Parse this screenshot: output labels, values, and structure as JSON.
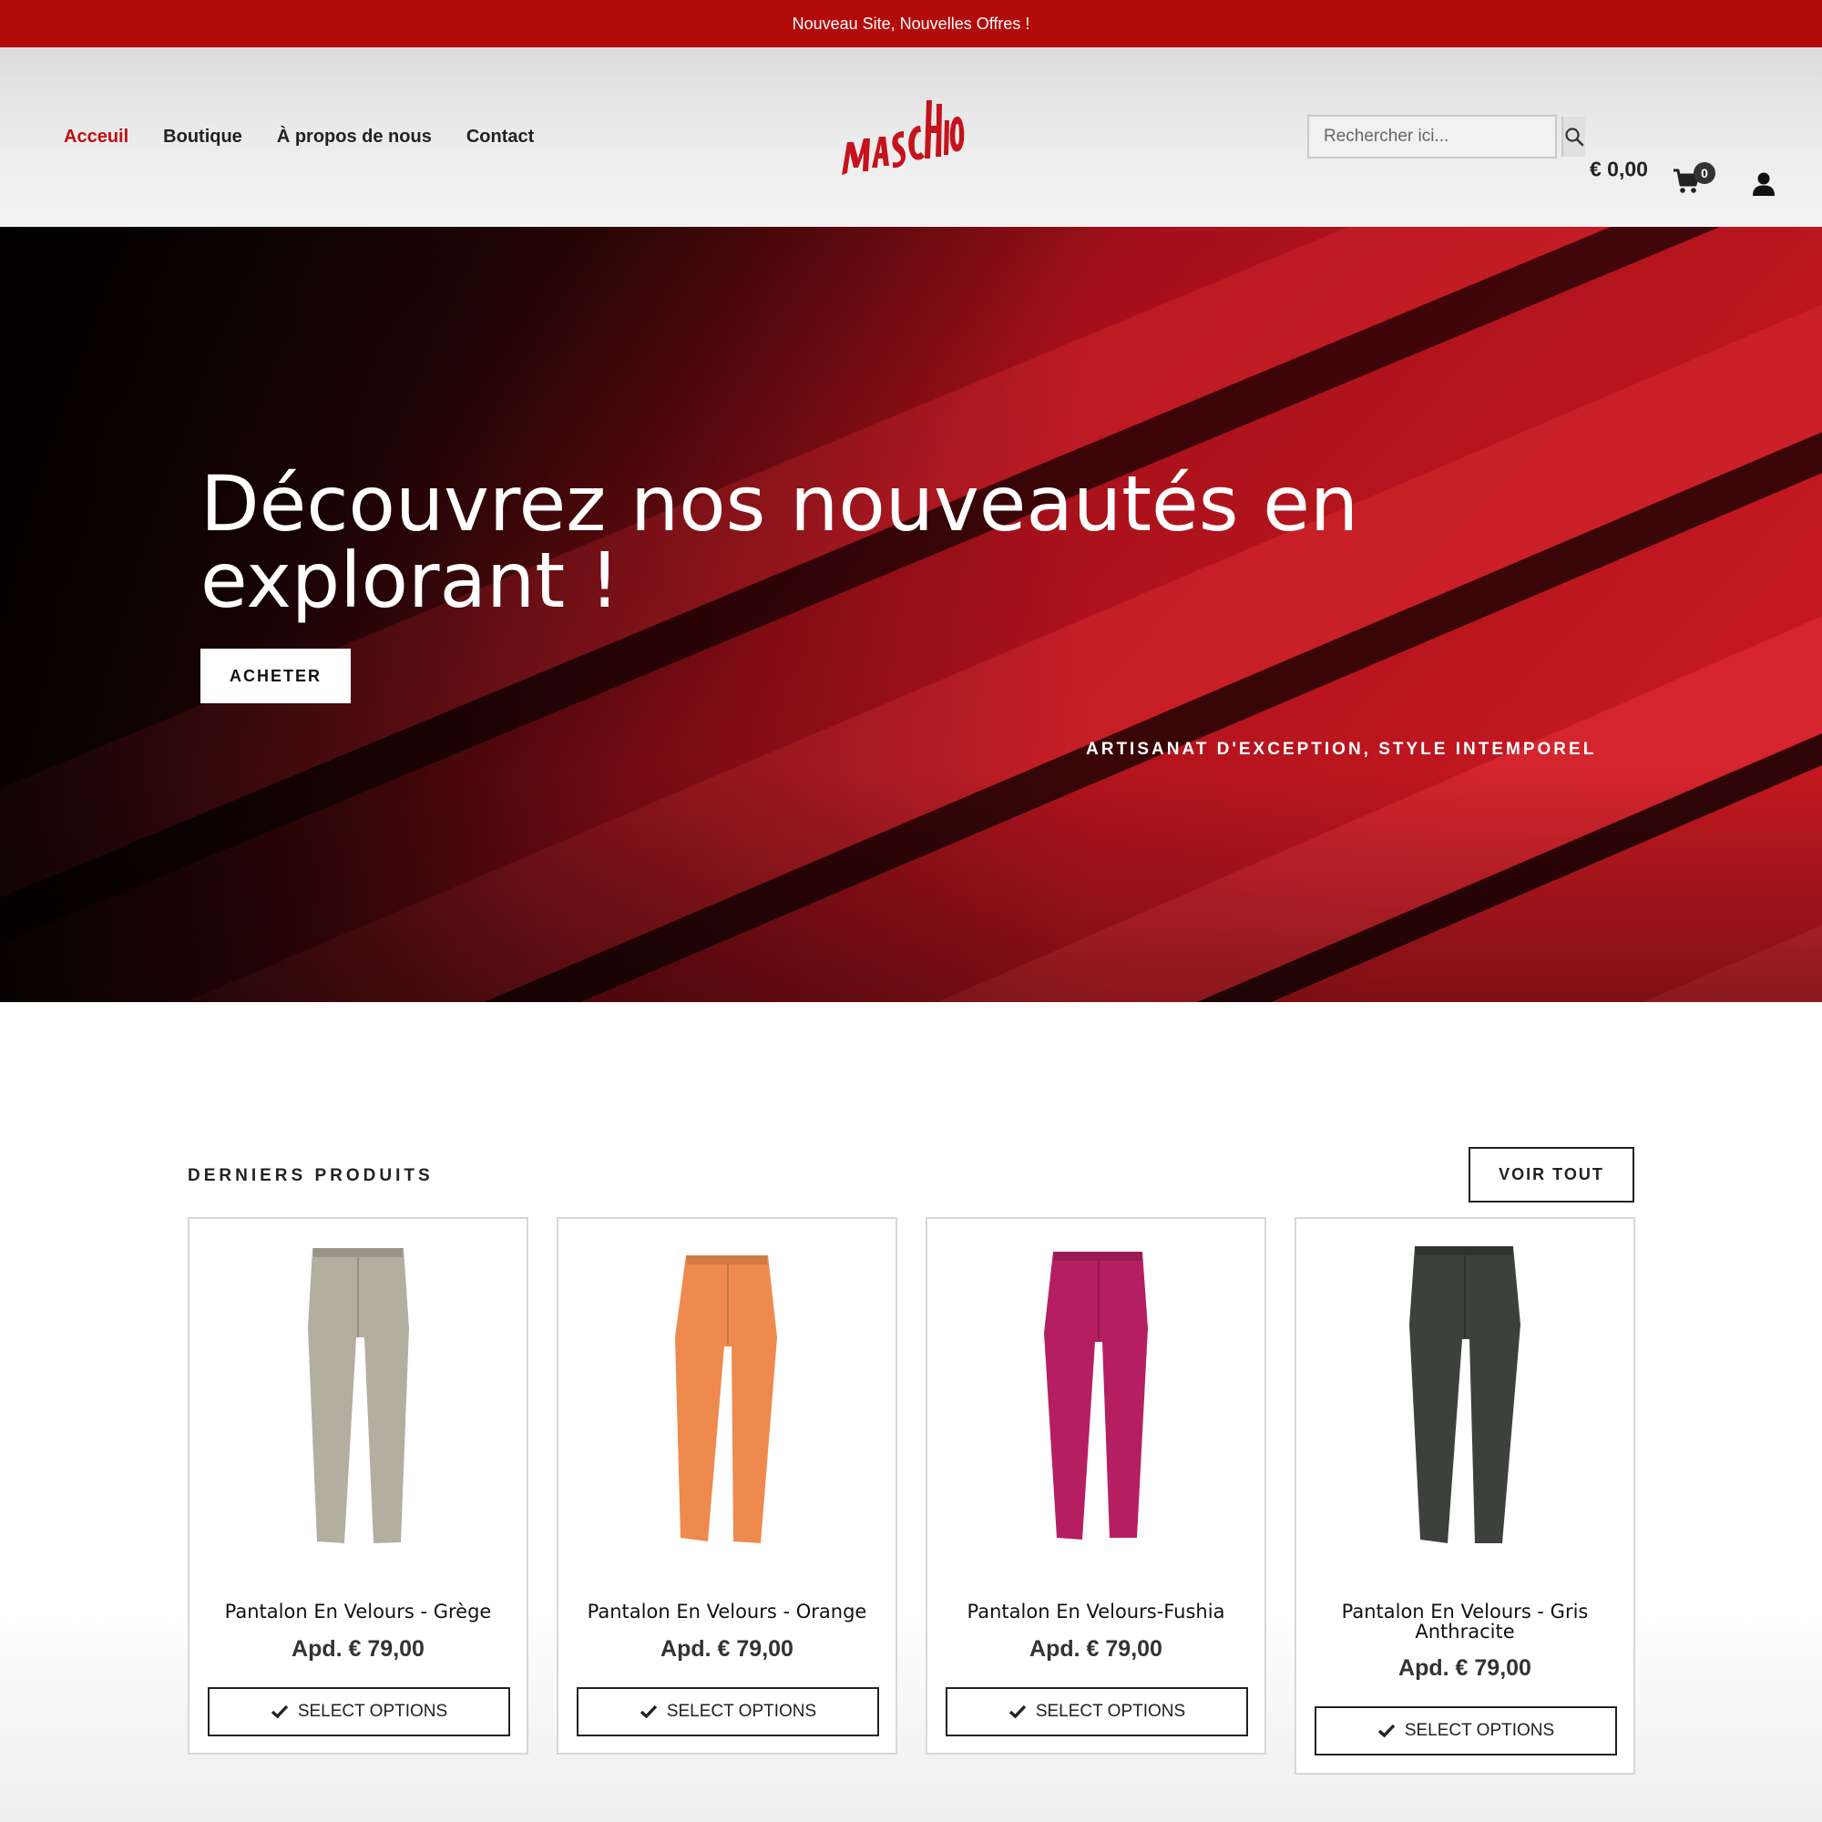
{
  "promo": {
    "text": "Nouveau Site, Nouvelles Offres !"
  },
  "header": {
    "nav": [
      {
        "label": "Acceuil",
        "active": true
      },
      {
        "label": "Boutique",
        "active": false
      },
      {
        "label": "À propos de nous",
        "active": false
      },
      {
        "label": "Contact",
        "active": false
      }
    ],
    "logo_text": "MASCHIO",
    "search": {
      "placeholder": "Rechercher ici..."
    },
    "cart": {
      "total": "€ 0,00",
      "count": "0"
    }
  },
  "hero": {
    "title": "Découvrez nos nouveautés en explorant !",
    "button": "ACHETER",
    "tagline": "ARTISANAT D'EXCEPTION, STYLE INTEMPOREL"
  },
  "products": {
    "section_title": "DERNIERS PRODUITS",
    "view_all": "VOIR TOUT",
    "items": [
      {
        "name": "Pantalon En Velours - Grège",
        "price": "Apd. € 79,00",
        "button": "SELECT OPTIONS",
        "color": "#b4aea0"
      },
      {
        "name": "Pantalon En Velours - Orange",
        "price": "Apd. € 79,00",
        "button": "SELECT OPTIONS",
        "color": "#ee8a4d"
      },
      {
        "name": "Pantalon En Velours-Fushia",
        "price": "Apd. € 79,00",
        "button": "SELECT OPTIONS",
        "color": "#b51f62"
      },
      {
        "name": "Pantalon En Velours - Gris Anthracite",
        "price": "Apd. € 79,00",
        "button": "SELECT OPTIONS",
        "color": "#3d413b"
      }
    ]
  },
  "colors": {
    "brand_red": "#b30a0a",
    "nav_active": "#c00f0f"
  }
}
